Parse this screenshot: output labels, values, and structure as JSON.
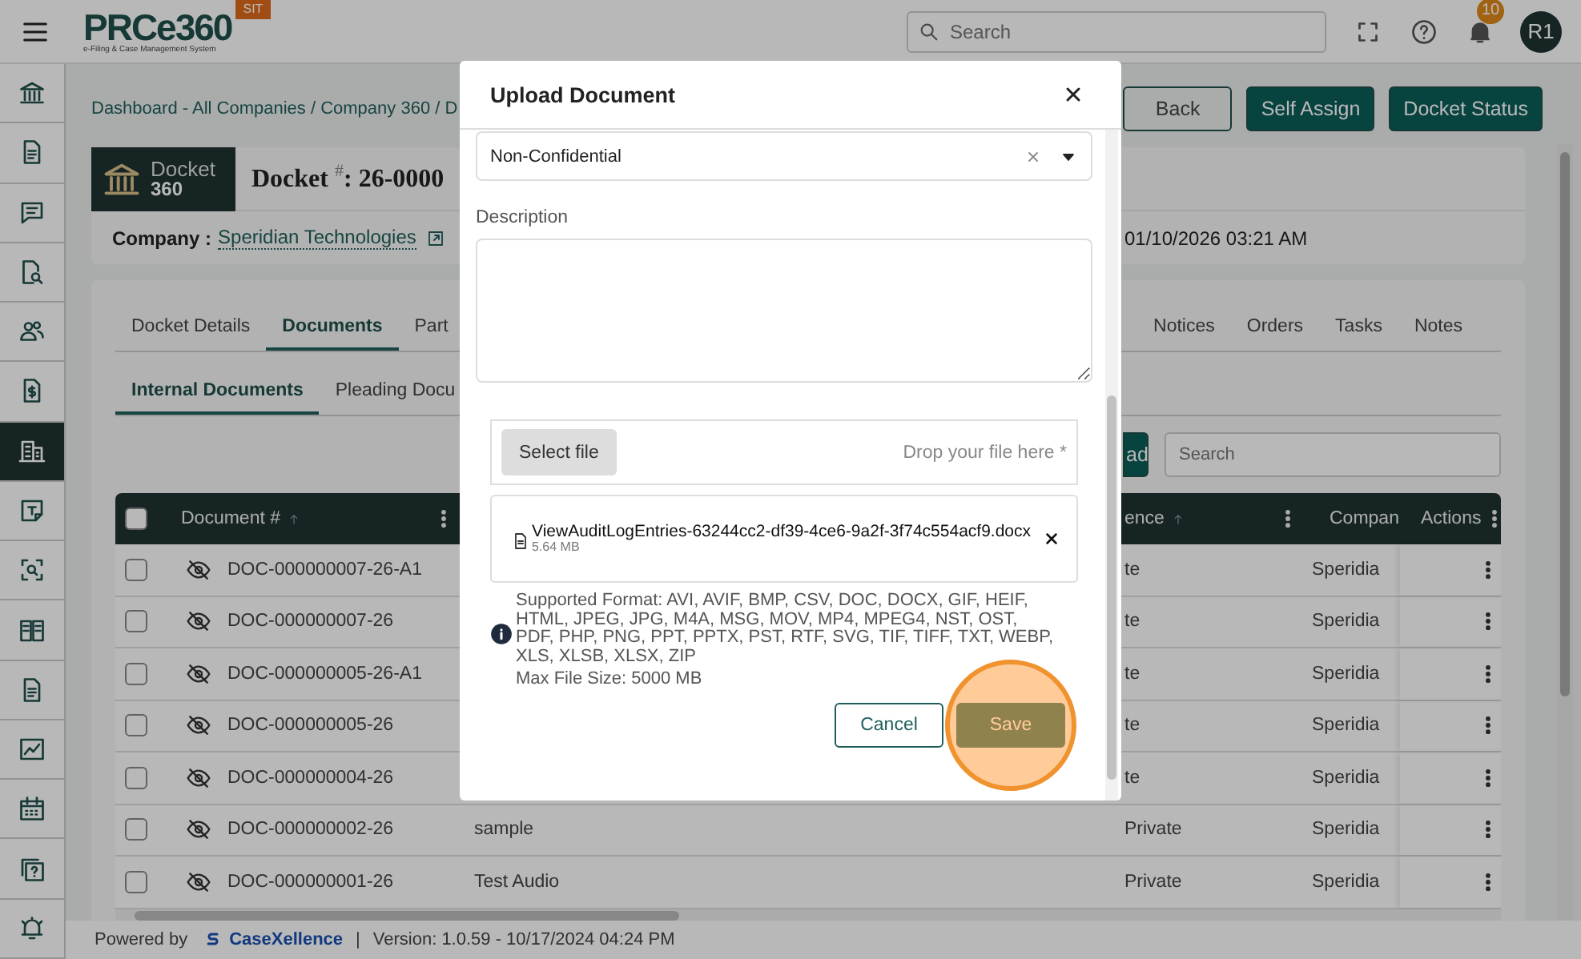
{
  "topbar": {
    "logo": "PRCe360",
    "logo_subtitle": "e-Filing & Case Management System",
    "env_badge": "SIT",
    "search": {
      "placeholder": "Search"
    },
    "notifications": "10",
    "avatar": "R1"
  },
  "sidebar": {
    "items": [
      {
        "selected": false
      },
      {
        "selected": false
      },
      {
        "selected": false
      },
      {
        "selected": false
      },
      {
        "selected": false
      },
      {
        "selected": false
      },
      {
        "selected": true
      },
      {
        "selected": false
      },
      {
        "selected": false
      },
      {
        "selected": false
      },
      {
        "selected": false
      },
      {
        "selected": false
      },
      {
        "selected": false
      },
      {
        "selected": false
      },
      {
        "selected": false
      }
    ]
  },
  "breadcrumb": "Dashboard - All Companies / Company 360 / D",
  "actions": [
    {
      "label": "Back",
      "kind": "outline"
    },
    {
      "label": "Self Assign",
      "kind": "primary"
    },
    {
      "label": "Docket Status",
      "kind": "primary"
    }
  ],
  "docket": {
    "badge_title": "Docket",
    "badge_subtitle": "360",
    "title": "Docket $^{#}$: 26-0000",
    "company_label": "Company :",
    "company": "Speridian Technologies",
    "date": "01/10/2026 03:21 AM"
  },
  "tabs": [
    {
      "label": "Docket Details",
      "selected": false
    },
    {
      "label": "Documents",
      "selected": true
    },
    {
      "label": "Part",
      "selected": false
    }
  ],
  "tabs_right": [
    {
      "label": "Notices",
      "selected": false
    },
    {
      "label": "Orders",
      "selected": false
    },
    {
      "label": "Tasks",
      "selected": false
    },
    {
      "label": "Notes",
      "selected": false
    }
  ],
  "subtabs": [
    {
      "label": "Internal Documents",
      "selected": true
    },
    {
      "label": "Pleading Docu",
      "selected": false
    }
  ],
  "upload_button": "ad",
  "table_search": {
    "placeholder": "Search"
  },
  "table": {
    "select_all": {
      "checked": false
    },
    "columns": [
      {
        "label": "Document #",
        "sort": true,
        "menu": true
      },
      {
        "label": "ence",
        "sort": true,
        "menu": true
      },
      {
        "label": "Compan",
        "sort": false,
        "menu": false
      },
      {
        "label": "Actions",
        "sort": false,
        "menu": true
      }
    ],
    "rows": [
      {
        "checked": false,
        "document": "DOC-000000007-26-A1",
        "confidence": "te",
        "company": "Speridia"
      },
      {
        "checked": false,
        "document": "DOC-000000007-26",
        "confidence": "te",
        "company": "Speridia"
      },
      {
        "checked": false,
        "document": "DOC-000000005-26-A1",
        "confidence": "te",
        "company": "Speridia"
      },
      {
        "checked": false,
        "document": "DOC-000000005-26",
        "confidence": "te",
        "company": "Speridia"
      },
      {
        "checked": false,
        "document": "DOC-000000004-26",
        "confidence": "te",
        "company": "Speridia"
      },
      {
        "checked": false,
        "document": "DOC-000000002-26",
        "description": "sample",
        "confidence": "Private",
        "company": "Speridia"
      },
      {
        "checked": false,
        "document": "DOC-000000001-26",
        "description": "Test Audio",
        "confidence": "Private",
        "company": "Speridia"
      }
    ]
  },
  "footer": {
    "powered_by": "Powered by",
    "brand": "CaseXellence",
    "separator": "|",
    "version": "Version: 1.0.59 - 10/17/2024 04:24 PM"
  },
  "modal": {
    "title": "Upload Document",
    "confidentiality": {
      "value": "Non-Confidential"
    },
    "description_label": "Description",
    "select_file": "Select file",
    "drop_hint": "Drop your file here *",
    "file": {
      "name": "ViewAuditLogEntries-63244cc2-df39-4ce6-9a2f-3f74c554acf9.docx",
      "size": "5.64 MB"
    },
    "supported_formats": "Supported Format: AVI, AVIF, BMP, CSV, DOC, DOCX, GIF, HEIF, HTML, JPEG, JPG, M4A, MSG, MOV, MP4, MPEG4, NST, OST, PDF, PHP, PNG, PPT, PPTX, PST, RTF, SVG, TIF, TIFF, TXT, WEBP, XLS, XLSB, XLSX, ZIP",
    "max_size": "Max File Size: 5000 MB",
    "buttons": [
      {
        "label": "Cancel",
        "kind": "secondary",
        "highlighted": false
      },
      {
        "label": "Save",
        "kind": "primary",
        "highlighted": true
      }
    ]
  }
}
